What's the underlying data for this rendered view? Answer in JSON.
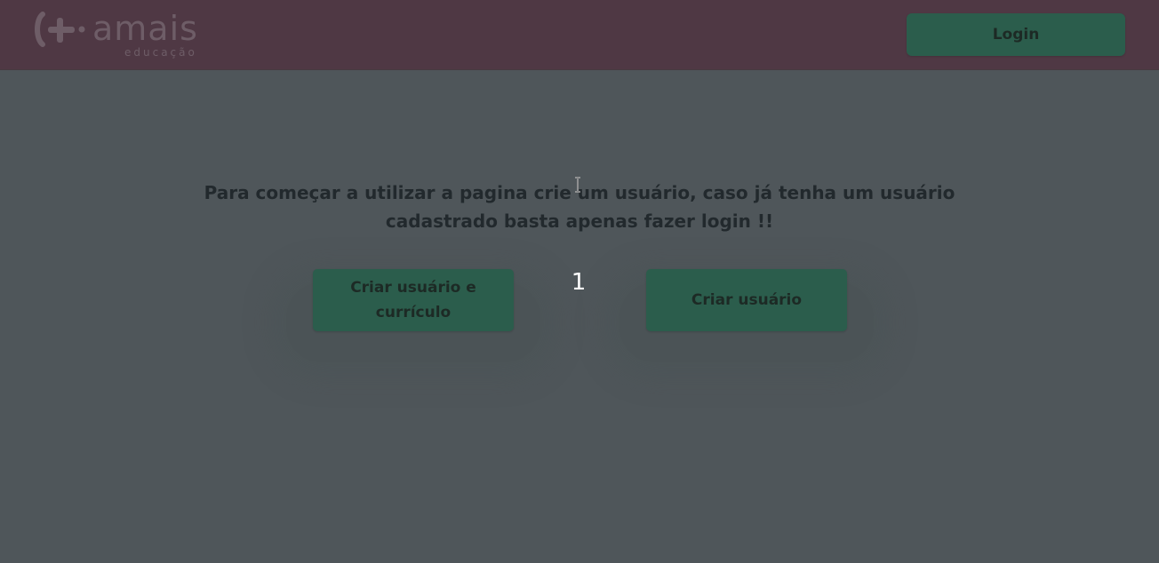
{
  "header": {
    "logo_name": "amais",
    "logo_tagline": "educação",
    "login_label": "Login"
  },
  "main": {
    "intro_line1": "Para começar a utilizar a pagina crie um usuário, caso já tenha um usuário",
    "intro_line2": "cadastrado basta apenas fazer login !!",
    "create_user_cv_label": "Criar usuário e currículo",
    "create_user_label": "Criar usuário",
    "counter": "1"
  },
  "colors": {
    "header_bg": "#4f3844",
    "page_bg": "#4f565a",
    "button_bg": "#2b5d4c",
    "button_text": "#1d2a25"
  },
  "icons": {
    "logo": "amais-plus-logo-icon",
    "cursor": "text-cursor-icon"
  }
}
